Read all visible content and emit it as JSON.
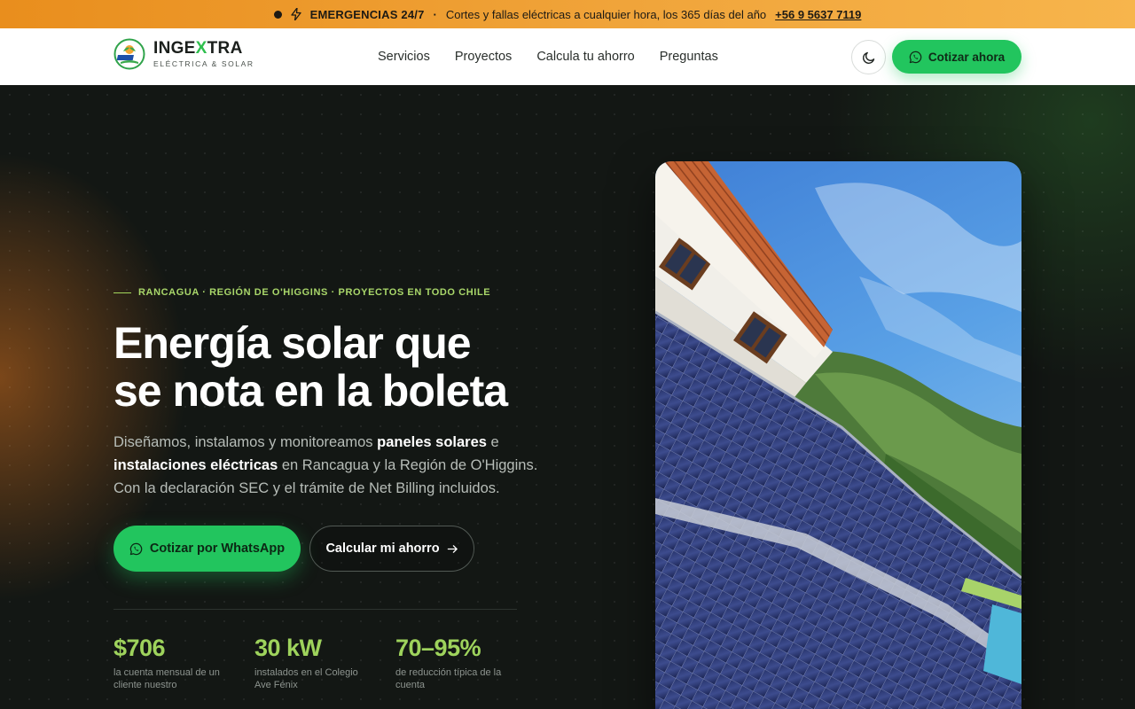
{
  "topbar": {
    "emergency": "EMERGENCIAS 24/7",
    "separator": "·",
    "message": "Cortes y fallas eléctricas a cualquier hora, los 365 días del año",
    "phone": "+56 9 5637 7119"
  },
  "nav": {
    "brand_part1": "INGE",
    "brand_part2": "X",
    "brand_part3": "TRA",
    "tagline": "ELÉCTRICA & SOLAR",
    "links": [
      "Servicios",
      "Proyectos",
      "Calcula tu ahorro",
      "Preguntas"
    ],
    "cta": "Cotizar ahora"
  },
  "hero": {
    "eyebrow": "RANCAGUA · REGIÓN DE O'HIGGINS · PROYECTOS EN TODO CHILE",
    "title_line1": "Energía solar que",
    "title_line2_plain": "se nota ",
    "title_line2_highlight": "en la boleta",
    "lead": {
      "p1": "Diseñamos, instalamos y monitoreamos ",
      "b1": "paneles solares",
      "p2": " e ",
      "b2": "instalaciones eléctricas",
      "p3": " en Rancagua y la Región de O'Higgins. Con la declaración SEC y el trámite de Net Billing incluidos."
    },
    "btn_whatsapp": "Cotizar por WhatsApp",
    "btn_calc": "Calcular mi ahorro",
    "stats": [
      {
        "value": "$706",
        "desc": "la cuenta mensual de un cliente nuestro"
      },
      {
        "value": "30 kW",
        "desc": "instalados en el Colegio Ave Fénix"
      },
      {
        "value": "70–95%",
        "desc": "de reducción típica de la cuenta"
      }
    ]
  },
  "colors": {
    "accent_green": "#22c55e",
    "stat_green": "#9ed35c",
    "topbar_orange": "#f0a43a",
    "hero_bg": "#131714"
  },
  "icons": {
    "theme": "moon-icon",
    "whatsapp": "whatsapp-icon",
    "arrow": "arrow-right-icon",
    "bolt": "bolt-icon"
  }
}
